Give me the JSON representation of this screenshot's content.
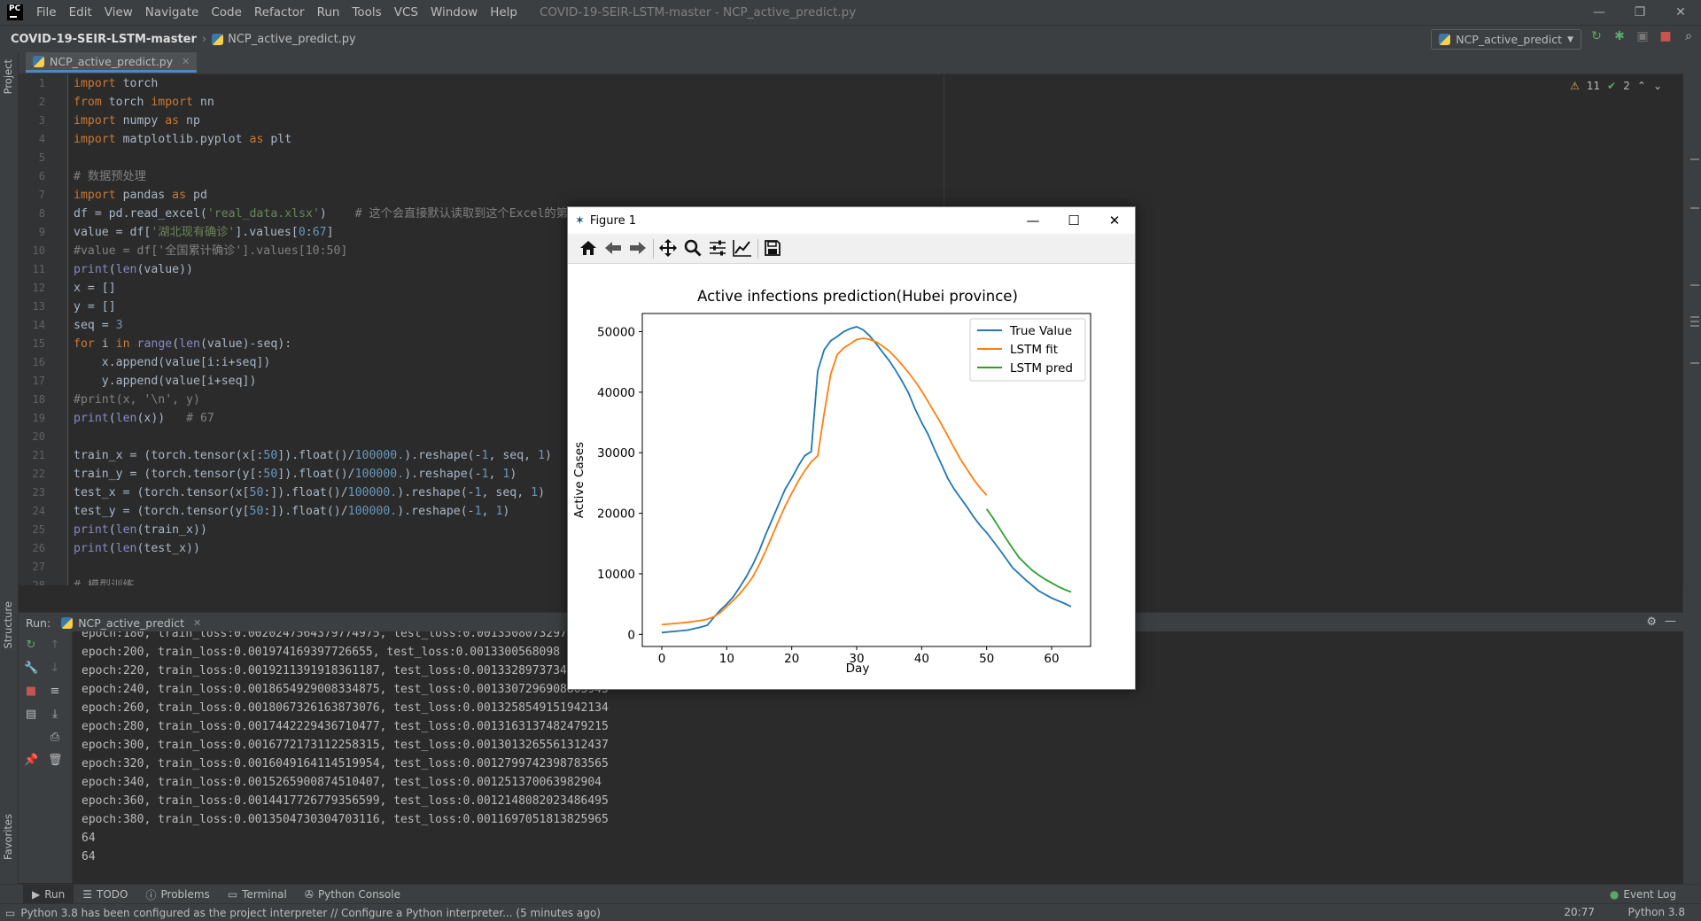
{
  "app": {
    "logo": "PC",
    "menu": [
      "File",
      "Edit",
      "View",
      "Navigate",
      "Code",
      "Refactor",
      "Run",
      "Tools",
      "VCS",
      "Window",
      "Help"
    ],
    "window_title": "COVID-19-SEIR-LSTM-master - NCP_active_predict.py",
    "window_controls": {
      "minimize": "—",
      "maximize": "❐",
      "close": "✕"
    }
  },
  "navbar": {
    "project": "COVID-19-SEIR-LSTM-master",
    "file": "NCP_active_predict.py",
    "run_config": "NCP_active_predict"
  },
  "stripes": {
    "left_top": "Project",
    "left_mid": "Structure",
    "left_bottom": "Favorites"
  },
  "editor": {
    "tab": "NCP_active_predict.py",
    "inspections": {
      "warnings": "11",
      "weak_warnings": "2"
    },
    "line_numbers": [
      "1",
      "2",
      "3",
      "4",
      "5",
      "6",
      "7",
      "8",
      "9",
      "10",
      "11",
      "12",
      "13",
      "14",
      "15",
      "16",
      "17",
      "18",
      "19",
      "20",
      "21",
      "22",
      "23",
      "24",
      "25",
      "26",
      "27",
      "28"
    ]
  },
  "run": {
    "label": "Run:",
    "tab": "NCP_active_predict",
    "console_lines": [
      "epoch:180, train_loss:0.0020247564379774975, test_loss:0.0013508073297456",
      "epoch:200, train_loss:0.001974169397726655, test_loss:0.0013300568098",
      "epoch:220, train_loss:0.0019211391918361187, test_loss:0.0013328973734",
      "epoch:240, train_loss:0.0018654929008334875, test_loss:0.0013307296908803945",
      "epoch:260, train_loss:0.0018067326163873076, test_loss:0.0013258549151942134",
      "epoch:280, train_loss:0.0017442229436710477, test_loss:0.0013163137482479215",
      "epoch:300, train_loss:0.0016772173112258315, test_loss:0.0013013265561312437",
      "epoch:320, train_loss:0.0016049164114519954, test_loss:0.0012799742398783565",
      "epoch:340, train_loss:0.0015265900874510407, test_loss:0.001251370063982904",
      "epoch:360, train_loss:0.0014417726779356599, test_loss:0.0012148082023486495",
      "epoch:380, train_loss:0.0013504730304703116, test_loss:0.0011697051813825965",
      "64",
      "64"
    ]
  },
  "bottom_tabs": [
    "Run",
    "TODO",
    "Problems",
    "Terminal",
    "Python Console"
  ],
  "event_log": "Event Log",
  "status": {
    "message": "Python 3.8 has been configured as the project interpreter // Configure a Python interpreter... (5 minutes ago)",
    "position": "20:77",
    "interpreter": "Python 3.8"
  },
  "figure": {
    "window_title": "Figure 1",
    "toolbar": [
      "home-icon",
      "back-icon",
      "forward-icon",
      "pan-icon",
      "zoom-icon",
      "configure-subplots-icon",
      "edit-axis-icon",
      "save-icon"
    ]
  },
  "chart_data": {
    "type": "line",
    "title": "Active infections prediction(Hubei province)",
    "xlabel": "Day",
    "ylabel": "Active Cases",
    "xlim": [
      -3,
      66
    ],
    "ylim": [
      -2000,
      53000
    ],
    "xticks": [
      0,
      10,
      20,
      30,
      40,
      50,
      60
    ],
    "yticks": [
      0,
      10000,
      20000,
      30000,
      40000,
      50000
    ],
    "legend": "top-right",
    "grid": false,
    "series": [
      {
        "name": "True Value",
        "color": "#1f77b4",
        "x": [
          0,
          2,
          4,
          6,
          7,
          8,
          9,
          10,
          11,
          12,
          13,
          14,
          15,
          16,
          17,
          18,
          19,
          20,
          21,
          22,
          23,
          24,
          25,
          26,
          27,
          28,
          29,
          30,
          31,
          32,
          33,
          34,
          35,
          36,
          37,
          38,
          39,
          40,
          41,
          42,
          43,
          44,
          45,
          46,
          47,
          48,
          49,
          50,
          52,
          54,
          56,
          58,
          60,
          62,
          63
        ],
        "y": [
          300,
          500,
          700,
          1200,
          1500,
          2800,
          4000,
          5000,
          6200,
          7800,
          9500,
          11500,
          13800,
          16500,
          19000,
          21500,
          24000,
          25800,
          27800,
          29500,
          30200,
          43500,
          47000,
          48500,
          49200,
          50000,
          50500,
          50800,
          50300,
          49300,
          48000,
          46600,
          45200,
          43600,
          41800,
          39800,
          37200,
          35000,
          33000,
          30500,
          28200,
          25800,
          24000,
          22500,
          21000,
          19400,
          18000,
          16800,
          14000,
          11000,
          9000,
          7200,
          6000,
          5100,
          4600
        ]
      },
      {
        "name": "LSTM fit",
        "color": "#ff7f0e",
        "x": [
          0,
          2,
          4,
          6,
          7,
          8,
          9,
          10,
          11,
          12,
          13,
          14,
          15,
          16,
          17,
          18,
          19,
          20,
          21,
          22,
          23,
          24,
          25,
          26,
          27,
          28,
          29,
          30,
          31,
          32,
          33,
          34,
          35,
          36,
          37,
          38,
          39,
          40,
          41,
          42,
          43,
          44,
          45,
          46,
          47,
          48,
          49,
          50
        ],
        "y": [
          1600,
          1800,
          2000,
          2300,
          2500,
          2900,
          3600,
          4600,
          5600,
          6700,
          8000,
          9500,
          11500,
          13800,
          16300,
          18800,
          21200,
          23300,
          25300,
          27000,
          28500,
          29500,
          36500,
          43000,
          46200,
          47300,
          48000,
          48700,
          48900,
          48700,
          48300,
          47600,
          46800,
          45700,
          44500,
          43200,
          41800,
          40200,
          38400,
          36600,
          34800,
          32800,
          30800,
          28900,
          27200,
          25600,
          24200,
          23000
        ]
      },
      {
        "name": "LSTM pred",
        "color": "#2ca02c",
        "x": [
          50,
          51,
          52,
          53,
          54,
          55,
          56,
          57,
          58,
          59,
          60,
          61,
          62,
          63
        ],
        "y": [
          20700,
          19200,
          17500,
          15800,
          14200,
          12700,
          11600,
          10600,
          9800,
          9100,
          8500,
          7900,
          7400,
          7000
        ]
      }
    ]
  }
}
